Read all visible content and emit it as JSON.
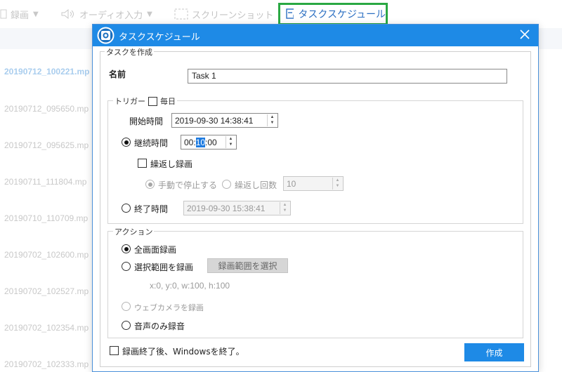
{
  "toolbar": {
    "record_label": "録画",
    "audio_label": "オーディオ入力",
    "screenshot_label": "スクリーンショット",
    "schedule_label": "タスクスケジュール"
  },
  "files": [
    "20190712_100221.mp",
    "20190712_095650.mp",
    "20190712_095625.mp",
    "20190711_111804.mp",
    "20190710_110709.mp",
    "20190702_102600.mp",
    "20190702_102527.mp",
    "20190702_102354.mp",
    "20190702_102333.mp"
  ],
  "dialog": {
    "title": "タスクスケジュール",
    "create_task_legend": "タスクを作成",
    "name_label": "名前",
    "name_value": "Task 1",
    "trigger_legend": "トリガー",
    "daily_label": "毎日",
    "start_time_label": "開始時間",
    "start_time_value": "2019-09-30 14:38:41",
    "duration_label": "継続時間",
    "duration_h": "00:",
    "duration_m": "10",
    "duration_s": ":00",
    "repeat_label": "繰返し録画",
    "manual_stop_label": "手動で停止する",
    "repeat_count_label": "繰返し回数",
    "repeat_count_value": "10",
    "end_time_label": "終了時間",
    "end_time_value": "2019-09-30 15:38:41",
    "action_legend": "アクション",
    "fullscreen_label": "全画面録画",
    "region_label": "選択範囲を録画",
    "select_region_button": "録画範囲を選択",
    "region_coords": "x:0, y:0, w:100, h:100",
    "webcam_label": "ウェブカメラを録画",
    "audio_only_label": "音声のみ録音",
    "shutdown_label": "録画終了後、Windowsを終了。",
    "create_button": "作成"
  },
  "colors": {
    "accent": "#1e8ae6",
    "highlight_border": "#2aa843"
  }
}
